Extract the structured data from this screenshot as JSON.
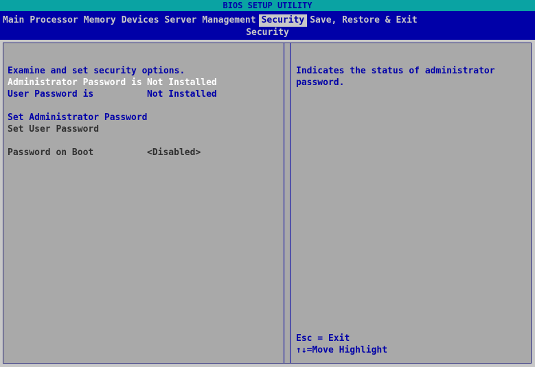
{
  "title": "BIOS SETUP UTILITY",
  "menu": {
    "items": [
      {
        "label": "Main"
      },
      {
        "label": "Processor"
      },
      {
        "label": "Memory"
      },
      {
        "label": "Devices"
      },
      {
        "label": "Server Management"
      },
      {
        "label": "Security"
      },
      {
        "label": "Save, Restore & Exit"
      }
    ],
    "active_index": 5,
    "subtitle": "Security"
  },
  "left": {
    "heading": "Examine and set security options.",
    "admin_password_label": "Administrator Password is",
    "admin_password_value": "Not Installed",
    "user_password_label": "User Password is",
    "user_password_value": "Not Installed",
    "set_admin_password": "Set Administrator Password",
    "set_user_password": "Set User Password",
    "password_on_boot_label": "Password on Boot",
    "password_on_boot_value": "<Disabled>"
  },
  "help": {
    "line1": "Indicates the status of administrator",
    "line2": "password.",
    "esc": "Esc = Exit",
    "move": "↑↓=Move Highlight"
  },
  "colors": {
    "title_bar": "#0aa3a3",
    "menu_bg": "#0000a8",
    "panel_bg": "#a9a9a9",
    "text_blue": "#0000a8",
    "text_white": "#ffffff"
  }
}
